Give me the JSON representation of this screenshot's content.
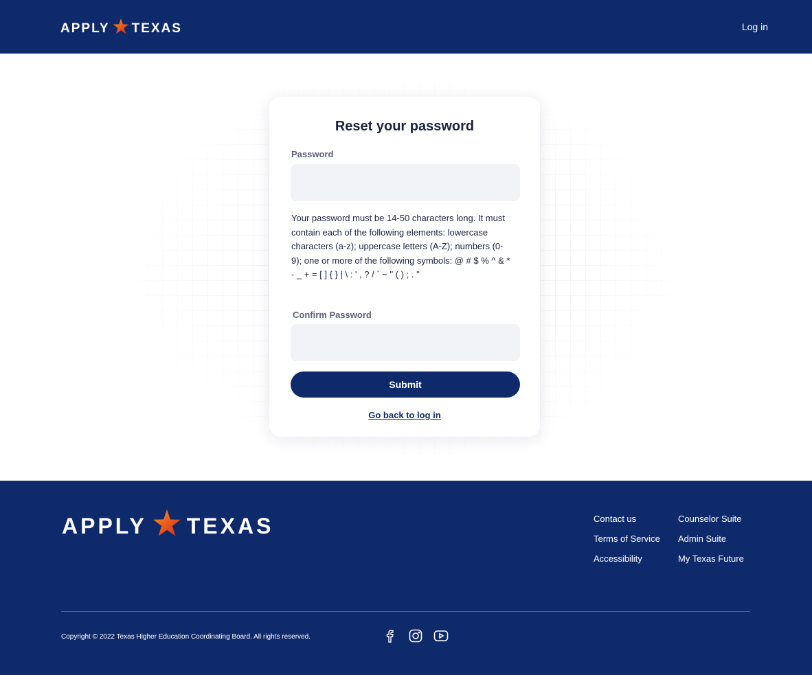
{
  "header": {
    "logo_left": "APPLY",
    "logo_right": "TEXAS",
    "login_label": "Log in"
  },
  "form": {
    "title": "Reset your password",
    "password_label": "Password",
    "password_value": "",
    "help_text": "Your password must be 14-50 characters long. It must contain each of the following elements: lowercase characters (a-z); uppercase letters (A-Z); numbers (0-9); one or more of the following symbols: @ # $ % ^ & * - _ + = [ ] { } | \\ : ' , ? / ` ~ \" ( ) ; . \"",
    "confirm_label": "Confirm Password",
    "confirm_value": "",
    "submit_label": "Submit",
    "back_label": "Go back to log in"
  },
  "footer": {
    "logo_left": "APPLY",
    "logo_right": "TEXAS",
    "links_col1": [
      "Contact us",
      "Terms of Service",
      "Accessibility"
    ],
    "links_col2": [
      "Counselor Suite",
      "Admin Suite",
      "My Texas Future"
    ],
    "copyright": "Copyright © 2022 Texas Higher Education Coordinating Board. All rights reserved.",
    "social_icons": [
      "facebook-icon",
      "instagram-icon",
      "youtube-icon"
    ]
  },
  "colors": {
    "brand_navy": "#0f2a6b",
    "star_orange": "#e8541a",
    "input_bg": "#f2f3f7"
  }
}
